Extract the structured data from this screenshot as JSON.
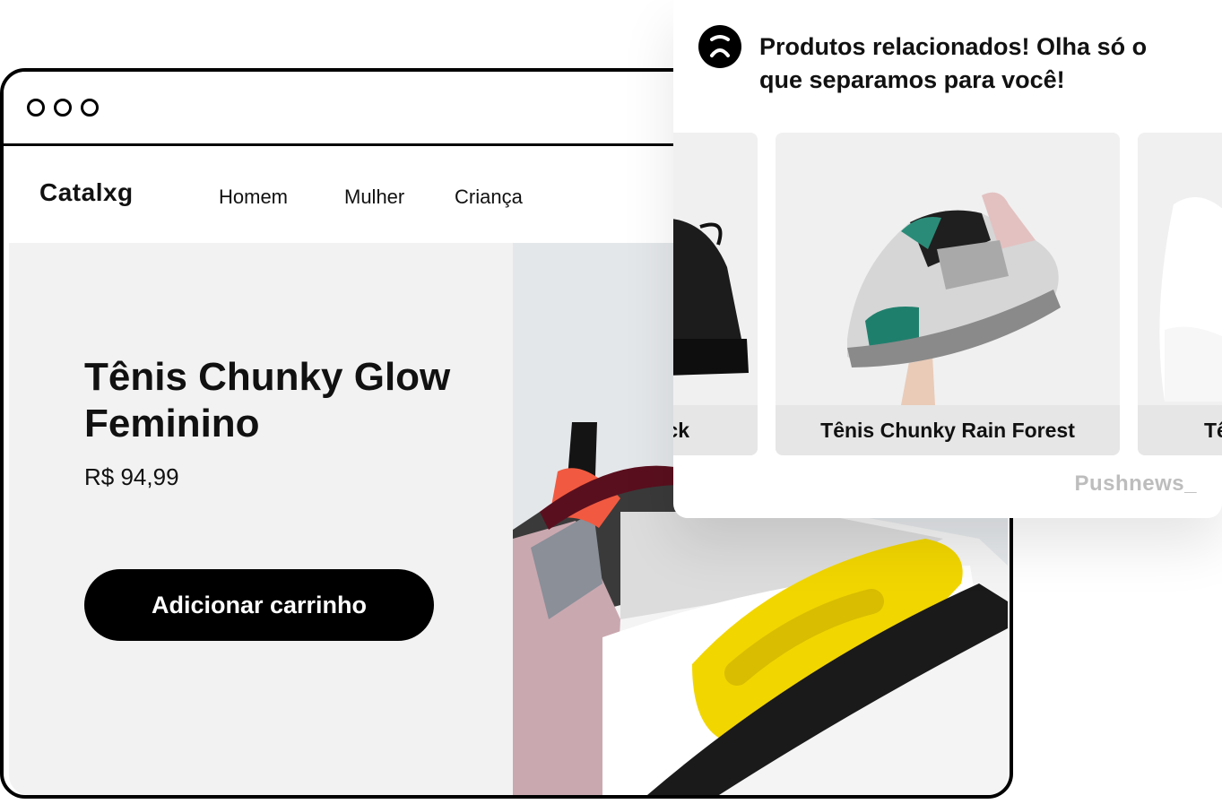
{
  "browser": {
    "window_controls": [
      "close",
      "minimize",
      "maximize"
    ]
  },
  "store": {
    "logo": "Catalxg",
    "nav": [
      {
        "label": "Homem"
      },
      {
        "label": "Mulher"
      },
      {
        "label": "Criança"
      }
    ]
  },
  "product": {
    "title": "Tênis Chunky Glow Feminino",
    "price": "R$ 94,99",
    "add_to_cart_label": "Adicionar carrinho"
  },
  "notification": {
    "title": "Produtos relacionados! Olha só o que separamos para você!",
    "cards": [
      {
        "label": "ck"
      },
      {
        "label": "Tênis Chunky Rain Forest"
      },
      {
        "label": "Tê"
      }
    ],
    "brand": "Pushnews_"
  },
  "colors": {
    "primary": "#000000",
    "hero_background": "#f2f2f2",
    "shoe_accent_yellow": "#f2d600",
    "brand_gray": "#bdbdbd"
  }
}
